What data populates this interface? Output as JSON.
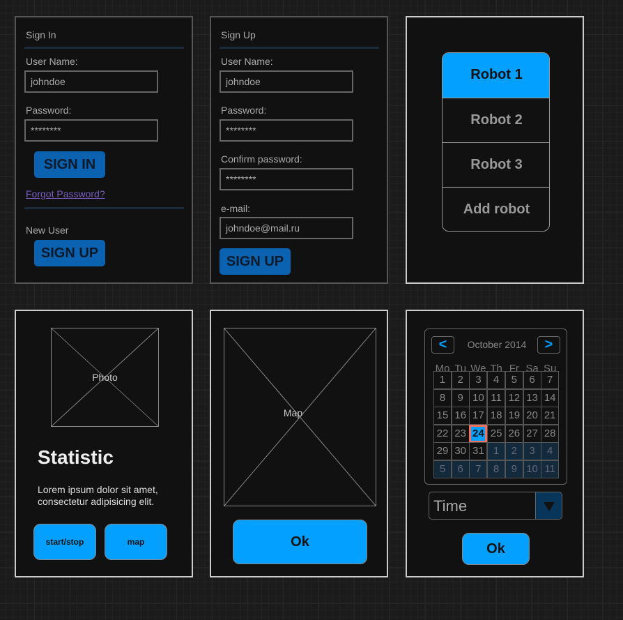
{
  "signin": {
    "title": "Sign In",
    "username_label": "User Name:",
    "username_value": "johndoe",
    "password_label": "Password:",
    "password_value": "********",
    "signin_button": "SIGN IN",
    "forgot_link": "Forgot Password?",
    "new_user_label": "New User",
    "signup_button": "SIGN UP"
  },
  "signup": {
    "title": "Sign Up",
    "username_label": "User Name:",
    "username_value": "johndoe",
    "password_label": "Password:",
    "password_value": "********",
    "confirm_label": "Confirm password:",
    "confirm_value": "********",
    "email_label": "e-mail:",
    "email_value": "johndoe@mail.ru",
    "signup_button": "SIGN UP"
  },
  "robots": {
    "items": [
      {
        "label": "Robot 1",
        "selected": true
      },
      {
        "label": "Robot 2"
      },
      {
        "label": "Robot 3"
      },
      {
        "label": "Add robot"
      }
    ]
  },
  "statistic": {
    "photo_label": "Photo",
    "title": "Statistic",
    "text": "Lorem ipsum dolor sit amet, consectetur adipisicing elit.",
    "start_stop_button": "start/stop",
    "map_button": "map"
  },
  "map": {
    "map_label": "Map",
    "ok_button": "Ok"
  },
  "calendar": {
    "prev": "<",
    "next": ">",
    "month": "October 2014",
    "weekdays": [
      "Mo",
      "Tu",
      "We",
      "Th",
      "Fr",
      "Sa",
      "Su"
    ],
    "days": [
      "1",
      "2",
      "3",
      "4",
      "5",
      "6",
      "7",
      "8",
      "9",
      "10",
      "11",
      "12",
      "13",
      "14",
      "15",
      "16",
      "17",
      "18",
      "19",
      "20",
      "21",
      "22",
      "23",
      "24",
      "25",
      "26",
      "27",
      "28",
      "29",
      "30",
      "31",
      "1",
      "2",
      "3",
      "4",
      "5",
      "6",
      "7",
      "8",
      "9",
      "10",
      "11"
    ],
    "selected_index": 23,
    "current_month_count": 31,
    "time_select": "Time",
    "ok_button": "Ok"
  },
  "colors": {
    "accent": "#03a0ff",
    "button_blue": "#0a62b0",
    "selected_outline": "#f07060"
  }
}
